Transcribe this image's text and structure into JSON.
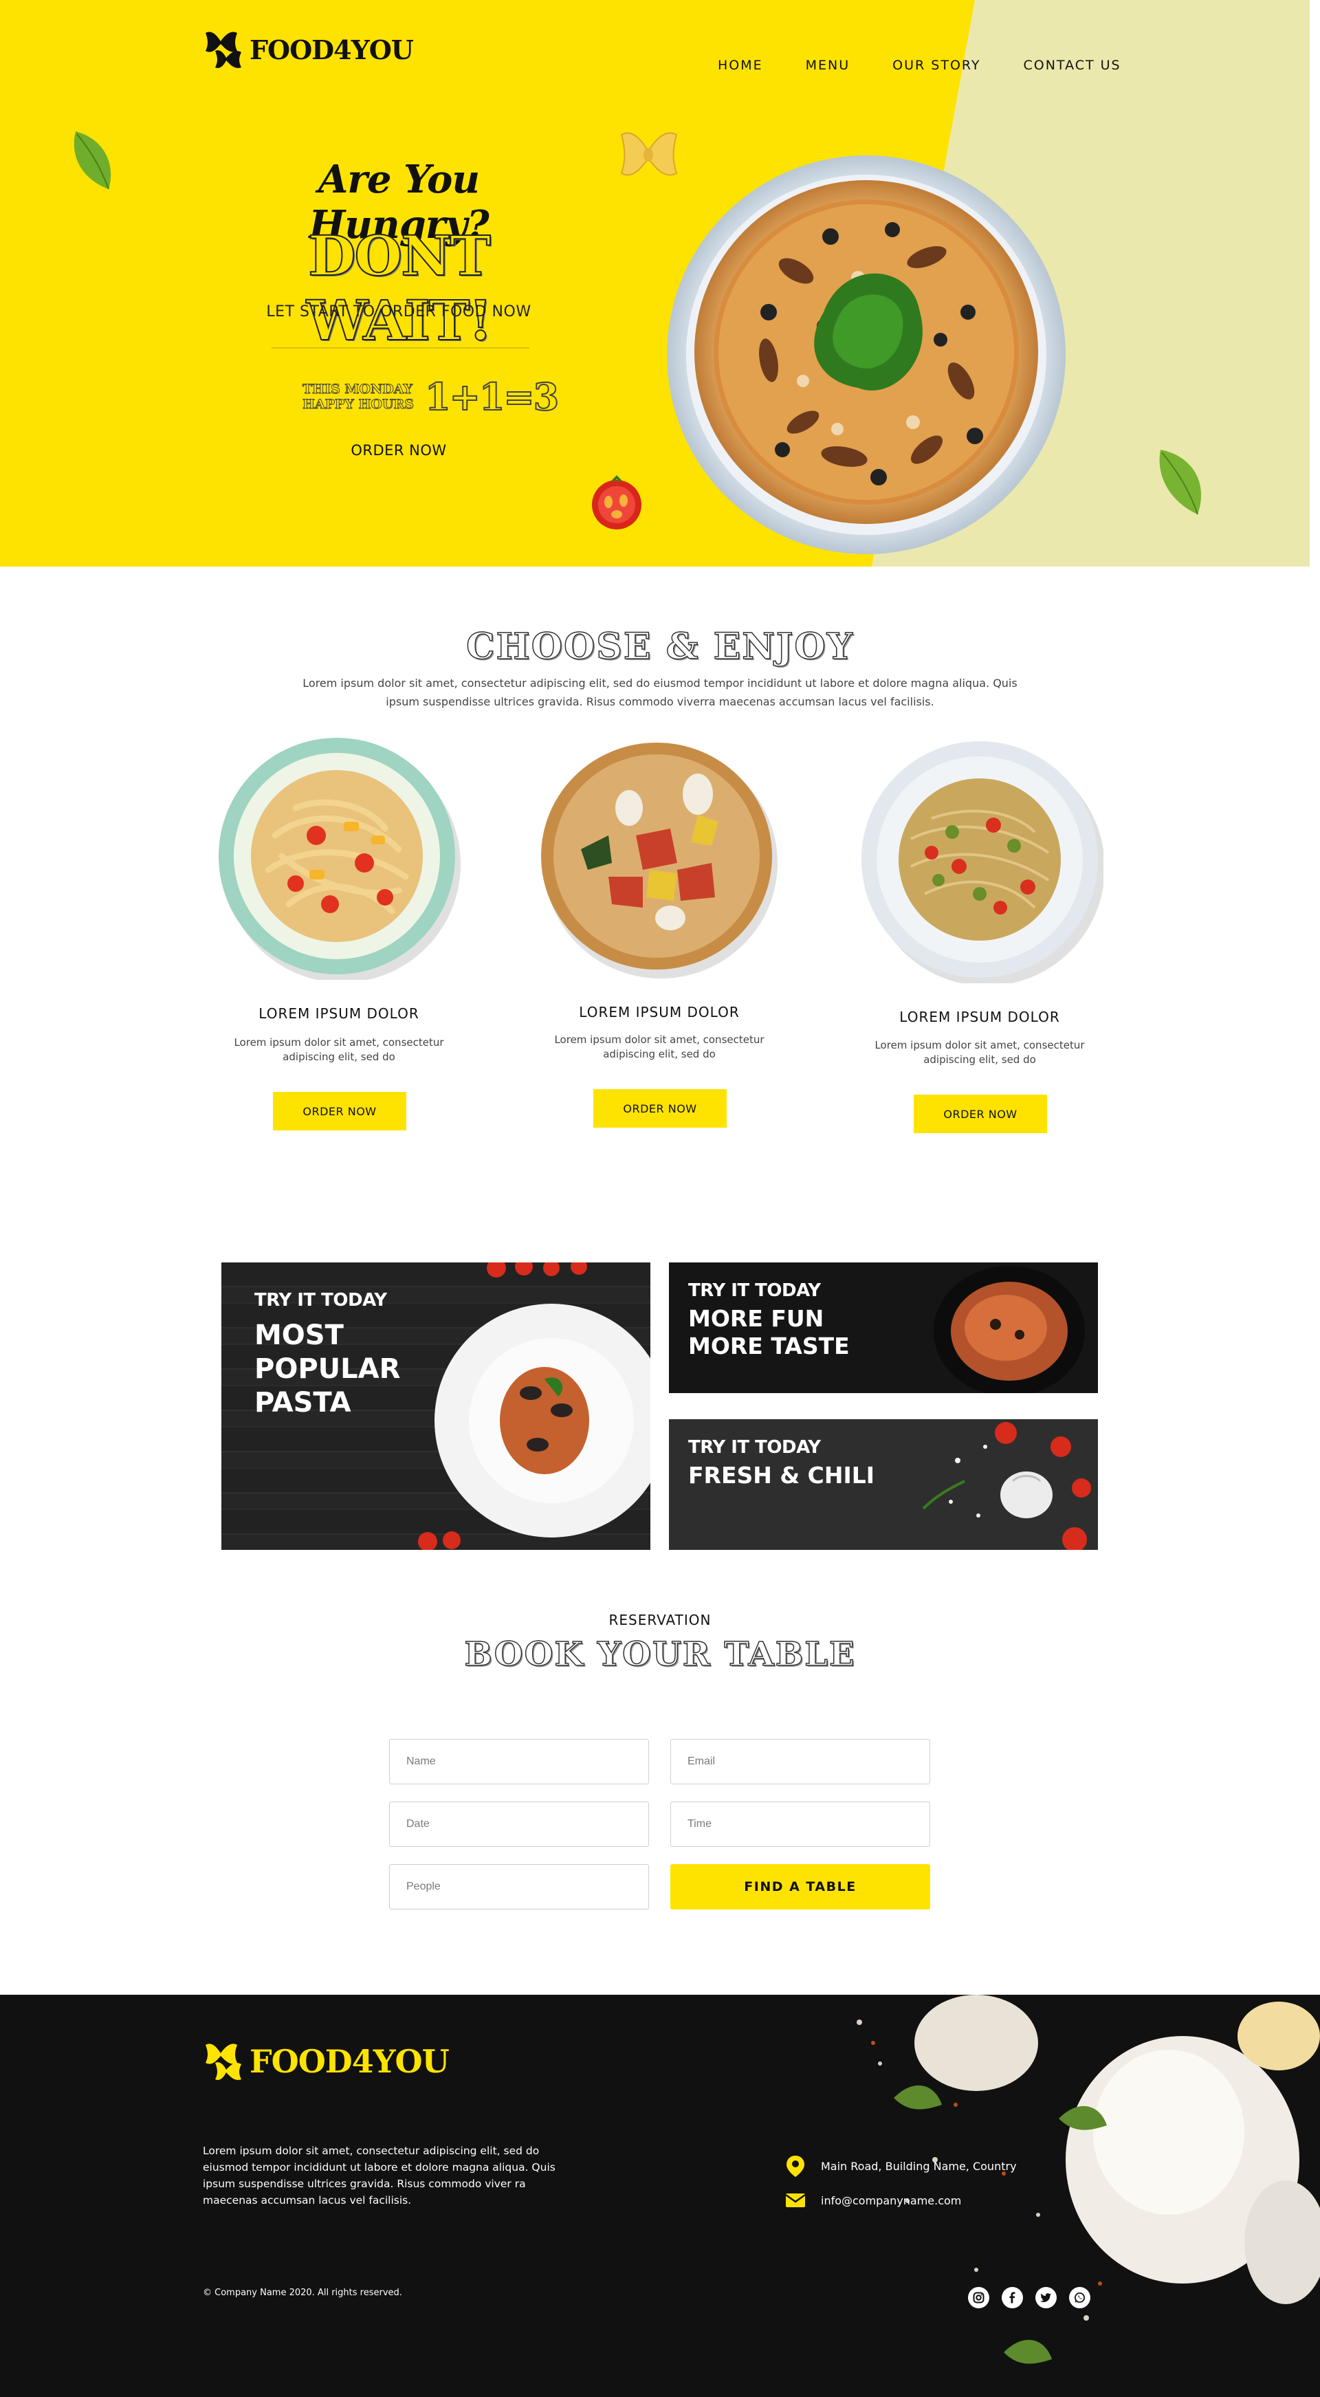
{
  "brand": {
    "name": "FOOD4YOU"
  },
  "nav": {
    "items": [
      "HOME",
      "MENU",
      "OUR STORY",
      "CONTACT US"
    ]
  },
  "hero": {
    "headline": "Are You Hungry?",
    "title": "DONT WAIT!",
    "subtitle": "LET START TO ORDER FOOD NOW",
    "promo_line1": "THIS MONDAY",
    "promo_line2": "HAPPY HOURS",
    "promo_offer": "1+1=3",
    "cta": "ORDER NOW"
  },
  "choose": {
    "title": "CHOOSE & ENJOY",
    "description": "Lorem ipsum dolor sit amet, consectetur adipiscing elit, sed do eiusmod tempor incididunt ut labore et dolore magna aliqua. Quis ipsum suspendisse ultrices gravida. Risus commodo viverra maecenas accumsan lacus vel facilisis.",
    "dishes": [
      {
        "title": "LOREM IPSUM DOLOR",
        "description": "Lorem ipsum dolor sit amet, consectetur adipiscing elit, sed do",
        "cta": "ORDER NOW"
      },
      {
        "title": "LOREM IPSUM DOLOR",
        "description": "Lorem ipsum dolor sit amet, consectetur adipiscing elit, sed do",
        "cta": "ORDER NOW"
      },
      {
        "title": "LOREM IPSUM DOLOR",
        "description": "Lorem ipsum dolor sit amet, consectetur adipiscing elit, sed do",
        "cta": "ORDER NOW"
      }
    ]
  },
  "promos": [
    {
      "kicker": "TRY IT TODAY",
      "line1": "MOST",
      "line2": "POPULAR",
      "line3": "PASTA"
    },
    {
      "kicker": "TRY IT TODAY",
      "line1": "MORE FUN",
      "line2": "MORE TASTE"
    },
    {
      "kicker": "TRY IT TODAY",
      "line1": "FRESH & CHILI"
    }
  ],
  "reservation": {
    "kicker": "RESERVATION",
    "title": "BOOK YOUR TABLE",
    "fields": {
      "name": "Name",
      "email": "Email",
      "date": "Date",
      "time": "Time",
      "people": "People"
    },
    "submit": "FIND A TABLE"
  },
  "footer": {
    "description": "Lorem ipsum dolor sit amet, consectetur adipiscing elit, sed do eiusmod tempor incididunt ut labore et dolore magna aliqua. Quis ipsum suspendisse ultrices gravida. Risus commodo viver ra maecenas accumsan lacus vel facilisis.",
    "address": "Main Road, Building Name, Country",
    "email": "info@companyname.com",
    "copyright": "© Company Name 2020. All rights reserved.",
    "socials": [
      "instagram-icon",
      "facebook-icon",
      "twitter-icon",
      "whatsapp-icon"
    ]
  },
  "colors": {
    "accent": "#ffe300",
    "accent_light": "#ebe8ad",
    "dark": "#111111"
  }
}
